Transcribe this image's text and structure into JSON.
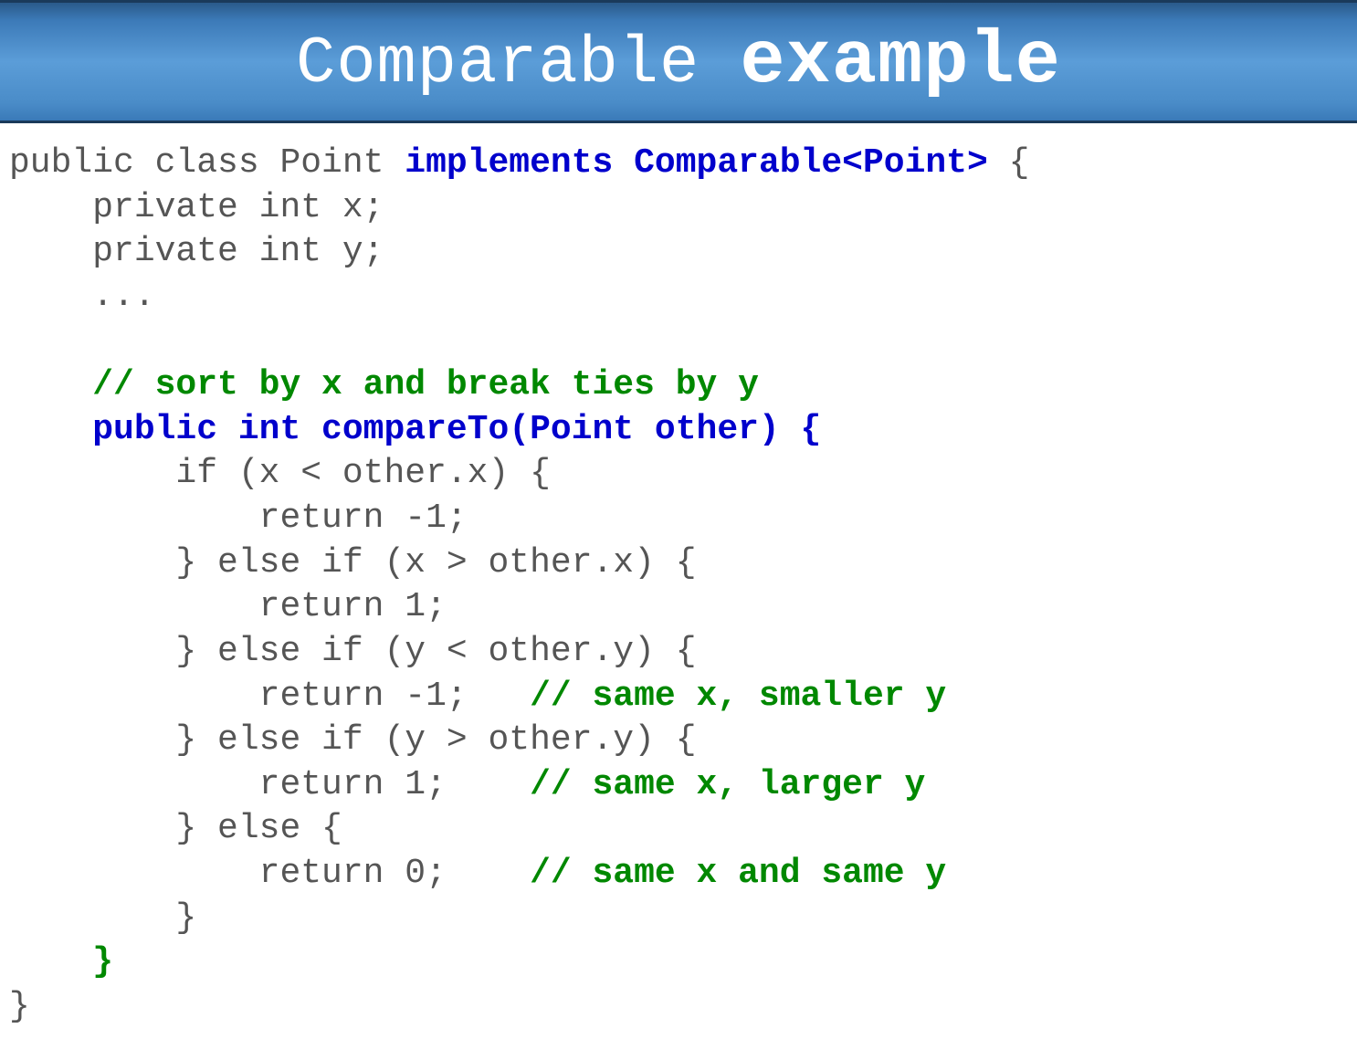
{
  "title": {
    "part1": "Comparable ",
    "part2": "example"
  },
  "code": {
    "l1a": "public class Point ",
    "l1b": "implements Comparable<Point>",
    "l1c": " {",
    "l2": "    private int x;",
    "l3": "    private int y;",
    "l4": "    ...",
    "l5": "",
    "l6": "    // sort by x and break ties by y",
    "l7": "    public int compareTo(Point other) {",
    "l8": "        if (x < other.x) {",
    "l9": "            return -1;",
    "l10": "        } else if (x > other.x) {",
    "l11": "            return 1;",
    "l12": "        } else if (y < other.y) {",
    "l13a": "            return -1;   ",
    "l13b": "// same x, smaller y",
    "l14": "        } else if (y > other.y) {",
    "l15a": "            return 1;    ",
    "l15b": "// same x, larger y",
    "l16": "        } else {",
    "l17a": "            return 0;    ",
    "l17b": "// same x and same y",
    "l18": "        }",
    "l19": "    }",
    "l20": "}"
  }
}
